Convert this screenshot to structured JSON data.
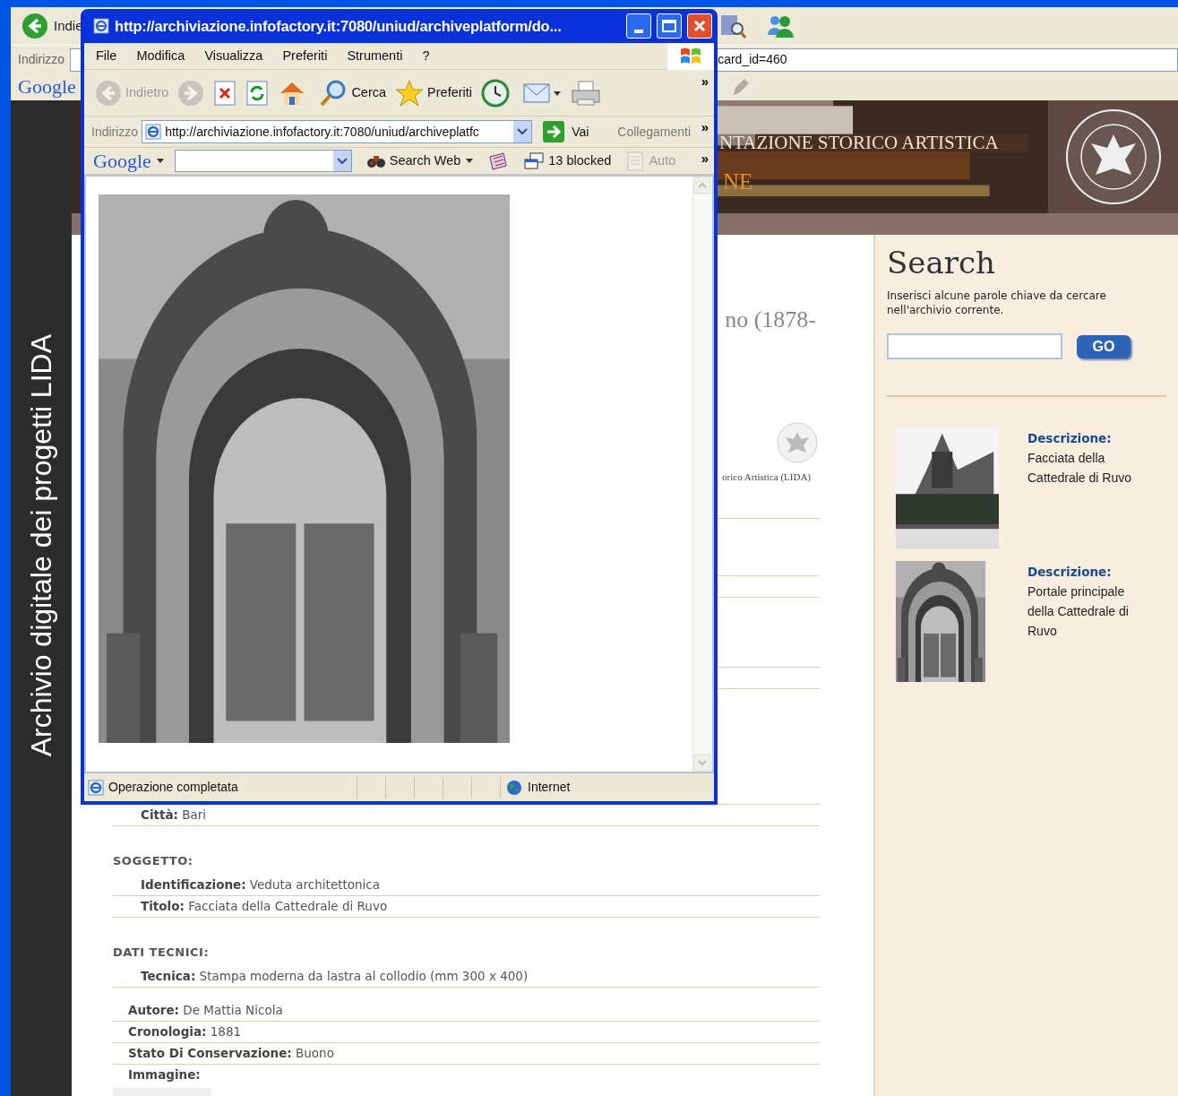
{
  "background_browser": {
    "back_label": "Indie",
    "address_label": "Indirizzo",
    "address_value": "card_id=460",
    "google_logo": "Google"
  },
  "site": {
    "sidebar_title": "Archivio digitale dei progetti LIDA",
    "banner_line_1": "NTAZIONE STORICO ARTISTICA",
    "banner_line_2": "NE",
    "heading_fragment": "no (1878-",
    "caption_fragment": "orico Artistica (LIDA)",
    "record": [
      {
        "kind": "section",
        "children": [
          {
            "label": "Città:",
            "value": "Bari"
          }
        ]
      },
      {
        "kind": "section",
        "title": "SOGGETTO:",
        "children": [
          {
            "label": "Identificazione:",
            "value": "Veduta architettonica"
          },
          {
            "label": "Titolo:",
            "value": "Facciata della Cattedrale di Ruvo"
          }
        ]
      },
      {
        "kind": "section",
        "title": "DATI TECNICI:",
        "children": [
          {
            "label": "Tecnica:",
            "value": "Stampa moderna da lastra al collodio (mm 300 x 400)"
          }
        ]
      },
      {
        "kind": "field",
        "label": "Autore:",
        "value": "De Mattia Nicola"
      },
      {
        "kind": "field",
        "label": "Cronologia:",
        "value": "1881"
      },
      {
        "kind": "field",
        "label": "Stato Di Conservazione:",
        "value": "Buono"
      },
      {
        "kind": "image_field",
        "label": "Immagine:"
      }
    ],
    "search": {
      "title": "Search",
      "hint": "Inserisci alcune parole chiave da cercare nell'archivio corrente.",
      "button": "GO"
    },
    "results": [
      {
        "label": "Descrizione:",
        "text": "Facciata della Cattedrale di Ruvo"
      },
      {
        "label": "Descrizione:",
        "text": "Portale principale della Cattedrale di Ruvo"
      }
    ]
  },
  "popup": {
    "title": "http://archiviazione.infofactory.it:7080/uniud/archiveplatform/do...",
    "menu": [
      "File",
      "Modifica",
      "Visualizza",
      "Preferiti",
      "Strumenti",
      "?"
    ],
    "toolbar": [
      {
        "kind": "back",
        "label": "Indietro",
        "disabled": true
      },
      {
        "kind": "forward",
        "disabled": true
      },
      {
        "kind": "stop",
        "disabled": false
      },
      {
        "kind": "refresh",
        "disabled": false
      },
      {
        "kind": "home",
        "disabled": false
      },
      {
        "kind": "search",
        "label": "Cerca",
        "disabled": false
      },
      {
        "kind": "favorites",
        "label": "Preferiti",
        "disabled": false
      },
      {
        "kind": "history",
        "disabled": false
      },
      {
        "kind": "mail",
        "disabled": false
      },
      {
        "kind": "print",
        "disabled": false
      }
    ],
    "toolbar_more": "»",
    "address_label": "Indirizzo",
    "address_value": "http://archiviazione.infofactory.it:7080/uniud/archiveplatfc",
    "go_label": "Vai",
    "links_label": "Collegamenti",
    "links_more": "»",
    "google_logo": "Google",
    "google_toolbar": [
      {
        "kind": "search_web",
        "label": "Search Web",
        "disabled": false
      },
      {
        "kind": "news",
        "disabled": false
      },
      {
        "kind": "blocker",
        "label": "13 blocked",
        "disabled": false
      },
      {
        "kind": "autofill",
        "label": "Auto",
        "disabled": true
      }
    ],
    "google_more": "»",
    "status_text": "Operazione completata",
    "zone": "Internet"
  }
}
